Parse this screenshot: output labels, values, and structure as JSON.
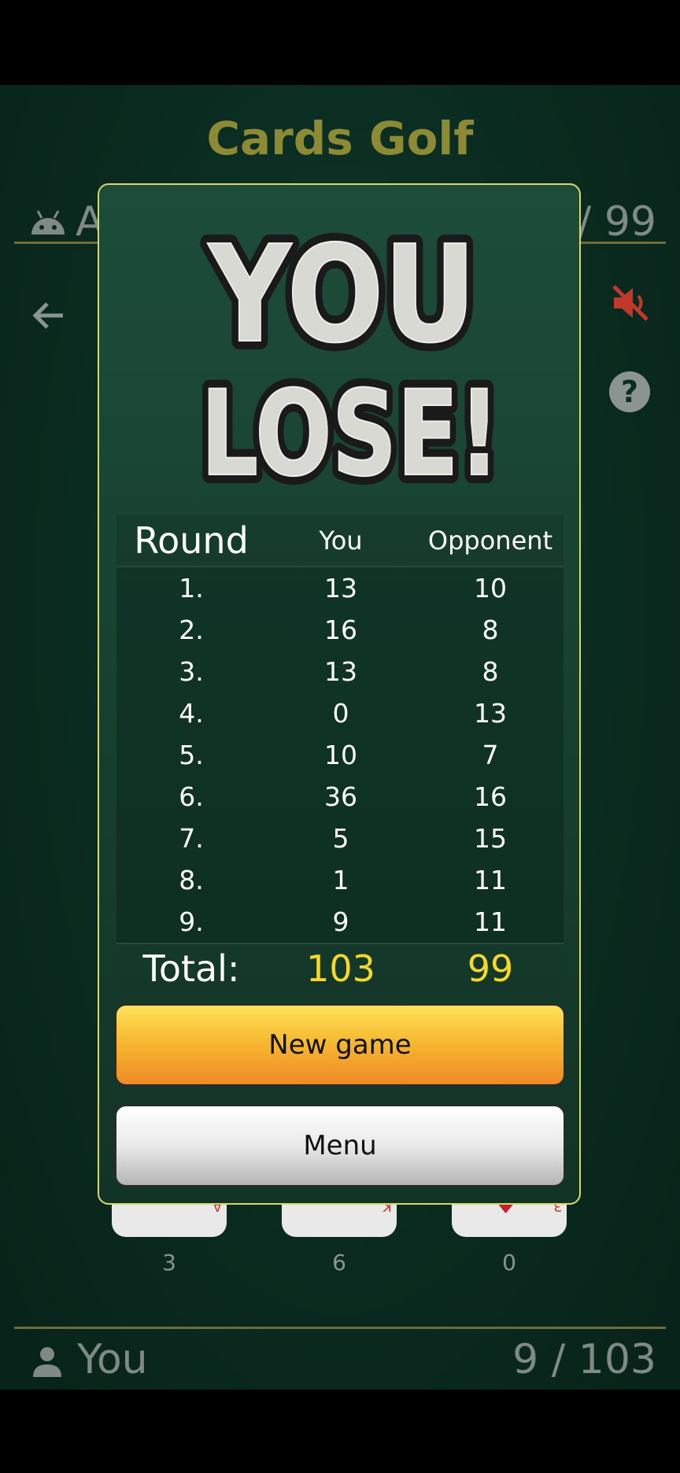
{
  "app": {
    "title": "Cards Golf",
    "opponent": {
      "name": "A",
      "score": "/ 99"
    },
    "player": {
      "name": "You",
      "score": "9 / 103"
    },
    "column_counts": [
      "3",
      "6",
      "0"
    ],
    "cards": [
      {
        "rank": "A"
      },
      {
        "rank": "K"
      },
      {
        "rank": "3"
      }
    ],
    "colors": {
      "background": "#0a2a1f",
      "title": "#8c8a35",
      "mute_icon": "#c0392b"
    }
  },
  "dialog": {
    "banner_line1": "YOU",
    "banner_line2": "LOSE!",
    "table": {
      "headers": [
        "Round",
        "You",
        "Opponent"
      ],
      "rows": [
        [
          "1.",
          "13",
          "10"
        ],
        [
          "2.",
          "16",
          "8"
        ],
        [
          "3.",
          "13",
          "8"
        ],
        [
          "4.",
          "0",
          "13"
        ],
        [
          "5.",
          "10",
          "7"
        ],
        [
          "6.",
          "36",
          "16"
        ],
        [
          "7.",
          "5",
          "15"
        ],
        [
          "8.",
          "1",
          "11"
        ],
        [
          "9.",
          "9",
          "11"
        ]
      ],
      "total_label": "Total:",
      "total_you": "103",
      "total_opponent": "99"
    },
    "new_game_label": "New game",
    "menu_label": "Menu",
    "colors": {
      "border": "#d8d76a",
      "total": "#f4d82a",
      "new_game": "#f6b52e"
    }
  }
}
